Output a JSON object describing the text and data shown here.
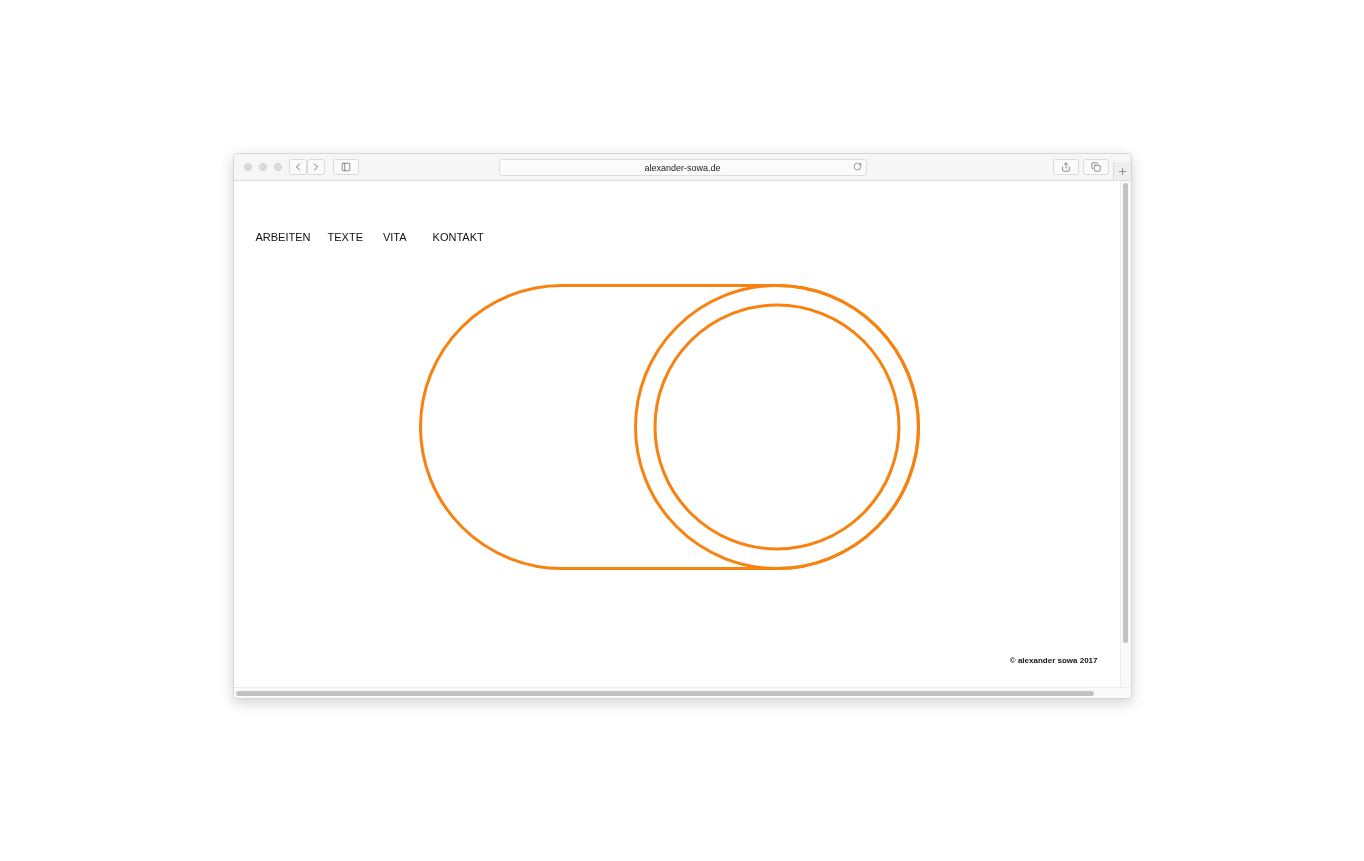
{
  "browser": {
    "url": "alexander-sowa.de"
  },
  "nav": [
    {
      "label": "ARBEITEN"
    },
    {
      "label": "TEXTE"
    },
    {
      "label": "VITA"
    },
    {
      "label": "KONTAKT"
    }
  ],
  "footer": {
    "copyright": "© alexander sowa 2017"
  }
}
